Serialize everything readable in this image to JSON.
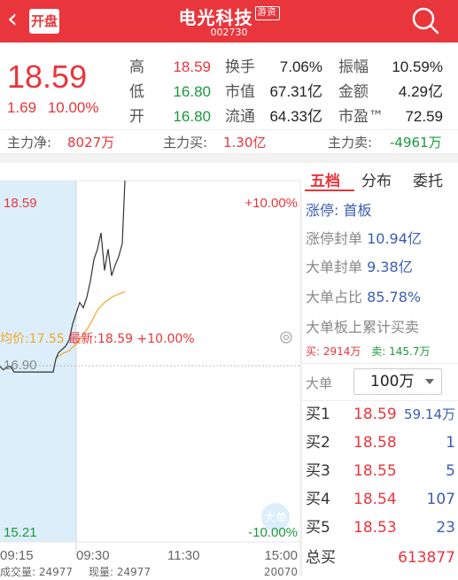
{
  "header": {
    "back_glyph": "‹",
    "kaipan": "开盘",
    "title": "电光科技",
    "tag": "游资",
    "code": "002730",
    "search_icon": "search-icon"
  },
  "quote": {
    "price": "18.59",
    "change": "1.69",
    "change_pct": "10.00%",
    "stats": [
      [
        {
          "label": "高",
          "value": "18.59",
          "color": "red"
        },
        {
          "label": "换手",
          "value": "7.06%",
          "color": "dark"
        },
        {
          "label": "振幅",
          "value": "10.59%",
          "color": "dark"
        }
      ],
      [
        {
          "label": "低",
          "value": "16.80",
          "color": "green"
        },
        {
          "label": "市值",
          "value": "67.31亿",
          "color": "dark"
        },
        {
          "label": "金额",
          "value": "4.29亿",
          "color": "dark"
        }
      ],
      [
        {
          "label": "开",
          "value": "16.80",
          "color": "green"
        },
        {
          "label": "流通",
          "value": "64.33亿",
          "color": "dark"
        },
        {
          "label": "市盈™",
          "value": "72.59",
          "color": "dark"
        }
      ]
    ]
  },
  "fund_flow": {
    "net_label": "主力净:",
    "net_value": "8027万",
    "buy_label": "主力买:",
    "buy_value": "1.30亿",
    "sell_label": "主力卖:",
    "sell_value": "-4961万"
  },
  "chart": {
    "avg_label": "均价:17.55",
    "latest_label": "最新:18.59",
    "latest_pct": "+10.00%",
    "eye_icon": "eye-icon",
    "y_top": "18.59",
    "y_mid": "16.90",
    "y_bottom": "15.21",
    "pct_top": "+10.00%",
    "pct_bottom": "-10.00%",
    "times": [
      "09:15",
      "09:30",
      "11:30",
      "15:00"
    ],
    "big_order_badge": "大单",
    "vol_label": "成交量: 24977",
    "cur_vol_label": "现量: 24977",
    "vol_axis": "20070"
  },
  "chart_data": {
    "type": "line",
    "x_labels": [
      "09:15",
      "09:30",
      "11:30",
      "15:00"
    ],
    "ylim": [
      15.21,
      18.59
    ],
    "reference": 16.9,
    "series": [
      {
        "name": "最新",
        "color": "#333333",
        "points": [
          [
            0,
            16.85
          ],
          [
            4,
            16.82
          ],
          [
            8,
            16.85
          ],
          [
            12,
            16.85
          ],
          [
            16,
            16.8
          ],
          [
            20,
            16.8
          ],
          [
            24,
            16.8
          ],
          [
            28,
            16.8
          ],
          [
            32,
            16.8
          ],
          [
            36,
            16.8
          ],
          [
            40,
            16.8
          ],
          [
            44,
            16.8
          ],
          [
            48,
            16.8
          ],
          [
            52,
            16.8
          ],
          [
            56,
            16.8
          ],
          [
            60,
            16.8
          ],
          [
            63,
            16.92
          ],
          [
            66,
            16.98
          ],
          [
            70,
            17.01
          ],
          [
            74,
            17.04
          ],
          [
            78,
            17.1
          ],
          [
            82,
            17.25
          ],
          [
            86,
            17.35
          ],
          [
            90,
            17.45
          ],
          [
            94,
            17.4
          ],
          [
            98,
            17.5
          ],
          [
            102,
            17.65
          ],
          [
            106,
            17.85
          ],
          [
            110,
            17.95
          ],
          [
            114,
            18.1
          ],
          [
            118,
            17.75
          ],
          [
            122,
            17.95
          ],
          [
            126,
            17.7
          ],
          [
            130,
            17.8
          ],
          [
            134,
            17.88
          ],
          [
            138,
            18.0
          ],
          [
            141,
            18.59
          ]
        ]
      },
      {
        "name": "均价",
        "color": "#f5a623",
        "points": [
          [
            63,
            16.93
          ],
          [
            70,
            16.97
          ],
          [
            78,
            17.0
          ],
          [
            86,
            17.06
          ],
          [
            94,
            17.15
          ],
          [
            102,
            17.25
          ],
          [
            110,
            17.38
          ],
          [
            118,
            17.45
          ],
          [
            126,
            17.5
          ],
          [
            134,
            17.53
          ],
          [
            141,
            17.55
          ]
        ]
      }
    ]
  },
  "order_book": {
    "tabs": [
      "五档",
      "分布",
      "委托"
    ],
    "limit_label": "涨停:",
    "limit_value": "首板",
    "seal_label": "涨停封单",
    "seal_value": "10.94亿",
    "big_seal_label": "大单封单",
    "big_seal_value": "9.38亿",
    "big_ratio_label": "大单占比",
    "big_ratio_value": "85.78%",
    "big_cum_label": "大单板上累计买卖",
    "buy_label": "买:",
    "buy_value": "2914万",
    "sell_label": "卖:",
    "sell_value": "145.7万",
    "filter_label": "大单",
    "filter_value": "100万",
    "dropdown_icon": "chevron-down-icon",
    "levels": [
      {
        "label": "买1",
        "price": "18.59",
        "vol": "59.14万"
      },
      {
        "label": "买2",
        "price": "18.58",
        "vol": "1"
      },
      {
        "label": "买3",
        "price": "18.55",
        "vol": "5"
      },
      {
        "label": "买4",
        "price": "18.54",
        "vol": "107"
      },
      {
        "label": "买5",
        "price": "18.53",
        "vol": "23"
      }
    ],
    "total_label": "总买",
    "total_value": "613877"
  }
}
